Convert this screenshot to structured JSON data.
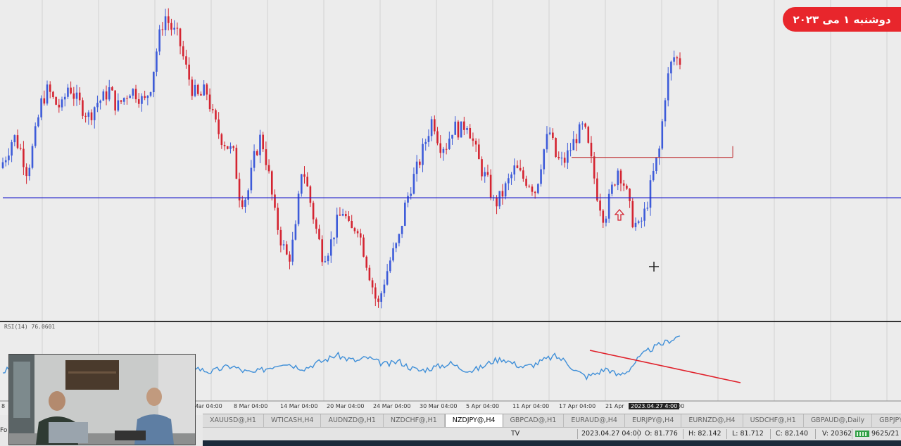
{
  "overlay": {
    "date_badge": "دوشنبه ۱ می ۲۰۲۳"
  },
  "indicator": {
    "label": "RSI(14) 76.0601"
  },
  "x_axis": {
    "ticks": [
      "8",
      "Mar 04:00",
      "8 Mar 04:00",
      "14 Mar 04:00",
      "20 Mar 04:00",
      "24 Mar 04:00",
      "30 Mar 04:00",
      "5 Apr 04:00",
      "11 Apr 04:00",
      "17 Apr 04:00",
      "21 Apr",
      "2023.04.27 4:00",
      "00"
    ]
  },
  "tabs": [
    {
      "label": "XAUUSD@,H1",
      "active": false
    },
    {
      "label": "WTICASH,H4",
      "active": false
    },
    {
      "label": "AUDNZD@,H1",
      "active": false
    },
    {
      "label": "NZDCHF@,H1",
      "active": false
    },
    {
      "label": "NZDJPY@,H4",
      "active": true
    },
    {
      "label": "GBPCAD@,H1",
      "active": false
    },
    {
      "label": "EURAUD@,H4",
      "active": false
    },
    {
      "label": "EURJPY@,H4",
      "active": false
    },
    {
      "label": "EURNZD@,H4",
      "active": false
    },
    {
      "label": "USDCHF@,H1",
      "active": false
    },
    {
      "label": "GBPAUD@,Daily",
      "active": false
    },
    {
      "label": "GBPJPY@,H1",
      "active": false
    }
  ],
  "status_bar": {
    "profile": "TV",
    "datetime": "2023.04.27 04:00",
    "open": "O: 81.776",
    "high": "H: 82.142",
    "low": "L: 81.712",
    "close": "C: 82.140",
    "volume": "V: 20362",
    "traffic": "9625/21"
  },
  "left_edge_text": "Fo",
  "colors": {
    "bull_candle": "#3d5bd9",
    "bear_candle": "#d42431",
    "support_line": "#2222cc",
    "resistance_line": "#c0393b",
    "rsi_line": "#3f8fd8",
    "divergence_line": "#e0202a",
    "badge": "#e8262c"
  },
  "icons": [
    "crosshair-icon",
    "up-arrow-icon",
    "connection-status-icon"
  ],
  "chart_data": {
    "type": "candlestick",
    "symbol": "NZDJPY@",
    "timeframe": "H4",
    "close_path": [
      81.2,
      81.5,
      81.9,
      81.6,
      81.1,
      81.8,
      82.6,
      82.9,
      82.6,
      82.5,
      83.0,
      82.7,
      82.5,
      82.3,
      82.6,
      82.7,
      82.9,
      82.5,
      82.7,
      82.9,
      82.8,
      82.6,
      83.0,
      83.9,
      84.5,
      84.2,
      84.0,
      83.4,
      82.9,
      82.7,
      82.9,
      82.3,
      81.9,
      81.7,
      81.5,
      80.5,
      80.6,
      81.4,
      81.9,
      81.2,
      80.2,
      79.6,
      79.2,
      79.8,
      81.3,
      80.6,
      79.9,
      79.3,
      79.5,
      80.0,
      80.3,
      79.8,
      80.0,
      79.4,
      78.8,
      78.2,
      78.8,
      79.3,
      79.6,
      80.4,
      80.9,
      81.3,
      81.8,
      82.3,
      81.7,
      81.7,
      82.1,
      82.0,
      82.2,
      81.7,
      81.2,
      80.9,
      80.4,
      80.6,
      80.9,
      81.2,
      81.0,
      80.9,
      80.7,
      81.5,
      82.0,
      81.4,
      81.3,
      81.6,
      81.9,
      82.1,
      81.4,
      80.6,
      80.1,
      80.7,
      81.2,
      80.8,
      80.1,
      79.9,
      80.3,
      81.0,
      81.6,
      83.0,
      83.6,
      83.5
    ],
    "support_level": 80.56,
    "resistance_level": 81.43,
    "ylim": [
      78.0,
      84.7
    ],
    "rsi_path": [
      46,
      50,
      54,
      48,
      45,
      44,
      47,
      52,
      56,
      53,
      50,
      55,
      54,
      47,
      44,
      41,
      45,
      50,
      53,
      48,
      46,
      49,
      51,
      47,
      45,
      48,
      51,
      54,
      51,
      49,
      53,
      56,
      60,
      57,
      55,
      58,
      54,
      52,
      55,
      50,
      47,
      49,
      51,
      53,
      49,
      47,
      50,
      55,
      57,
      53,
      50,
      52,
      56,
      59,
      55,
      47,
      42,
      45,
      49,
      43,
      47,
      57,
      64,
      68,
      72,
      76
    ],
    "rsi_ylim": [
      25,
      80
    ]
  }
}
